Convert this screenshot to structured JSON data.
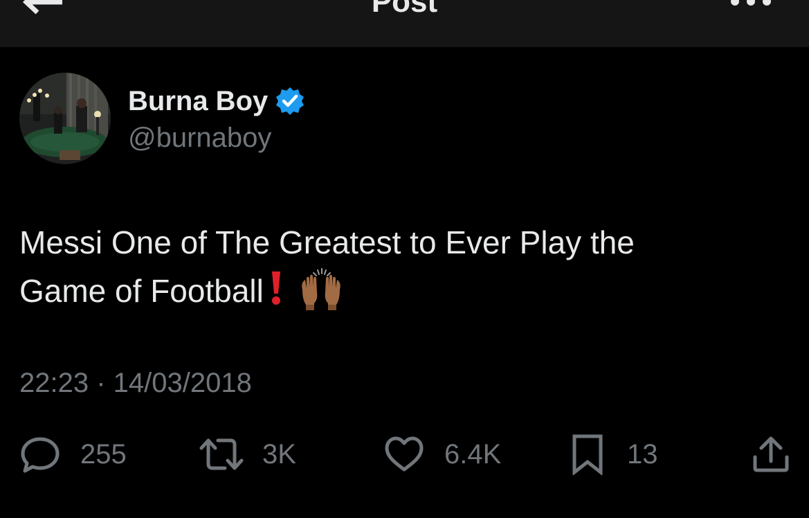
{
  "header": {
    "title": "Post",
    "back_icon": "arrow-left-icon",
    "more_icon": "more-horizontal-icon"
  },
  "author": {
    "display_name": "Burna Boy",
    "handle": "@burnaboy",
    "verified": true,
    "verified_color": "#1d9bf0"
  },
  "tweet": {
    "text_line_1": "Messi One of The Greatest to Ever Play the",
    "text_line_2": "Game of Football",
    "emojis": [
      "red-exclamation-mark-icon",
      "raising-hands-icon"
    ],
    "timestamp": "22:23 · 14/03/2018"
  },
  "actions": {
    "replies": "255",
    "reposts": "3K",
    "likes": "6.4K",
    "bookmarks": "13"
  },
  "colors": {
    "background": "#000000",
    "header_background": "#151515",
    "text_primary": "#e7e9ea",
    "text_secondary": "#71767b"
  }
}
